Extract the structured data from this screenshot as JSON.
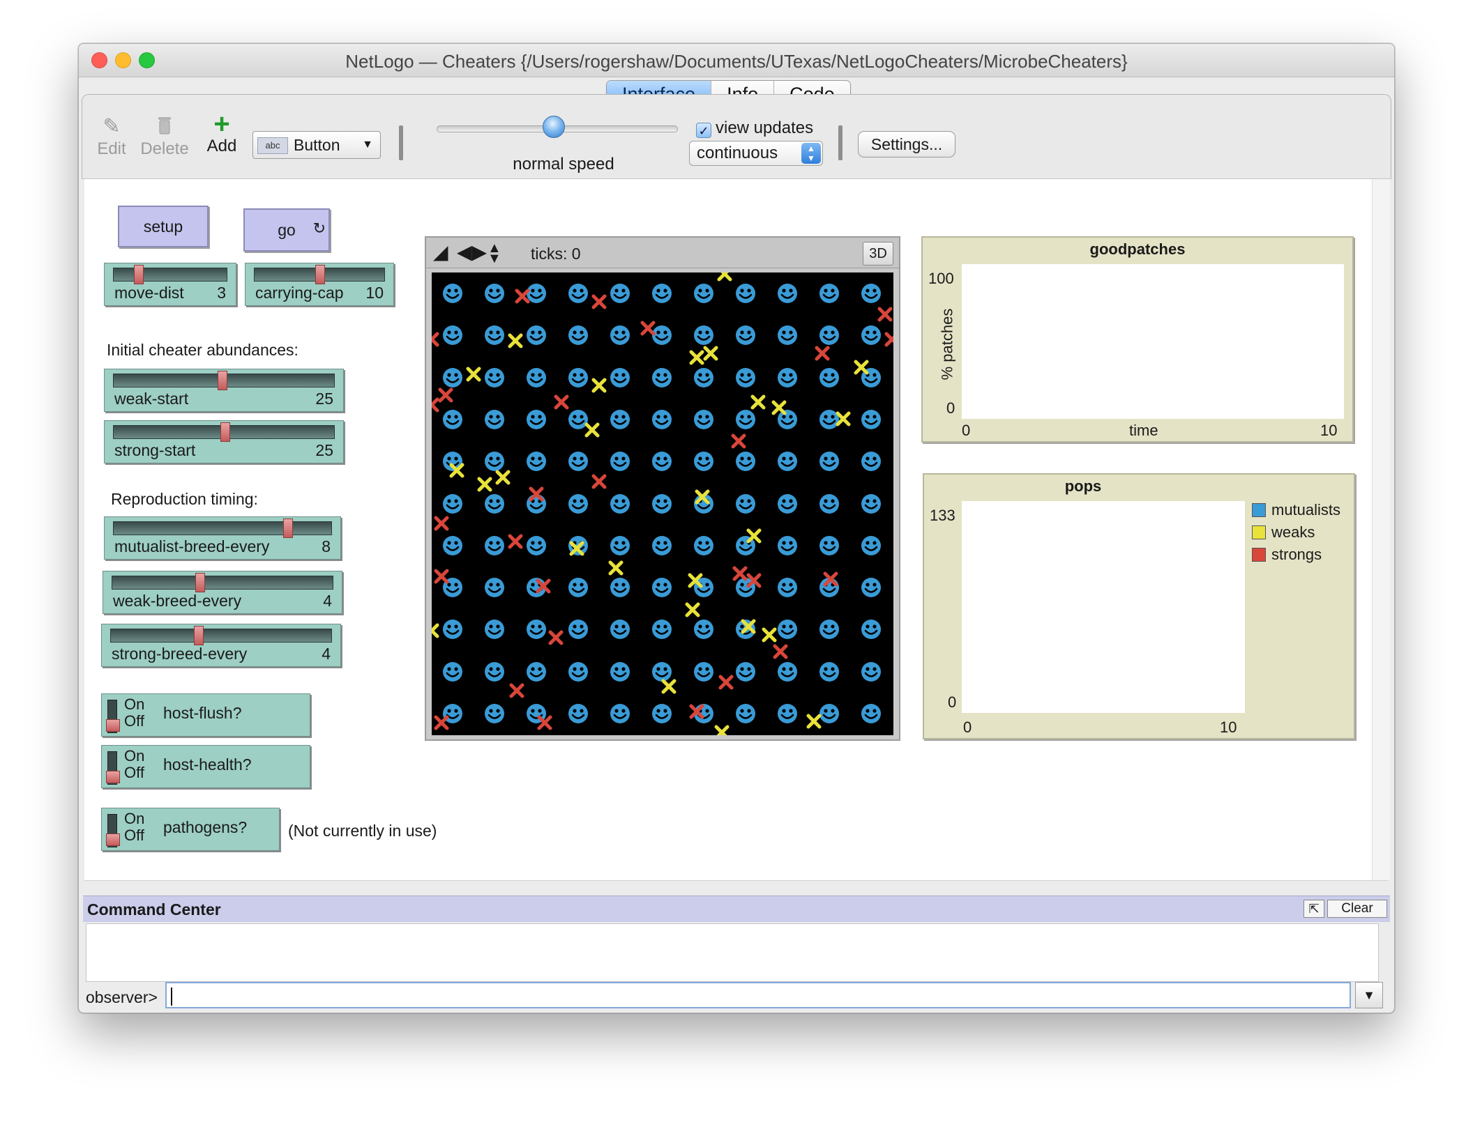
{
  "window": {
    "title": "NetLogo — Cheaters {/Users/rogershaw/Documents/UTexas/NetLogoCheaters/MicrobeCheaters}"
  },
  "tabs": [
    {
      "label": "Interface",
      "active": true
    },
    {
      "label": "Info",
      "active": false
    },
    {
      "label": "Code",
      "active": false
    }
  ],
  "toolbar": {
    "edit_label": "Edit",
    "delete_label": "Delete",
    "add_label": "Add",
    "widget_type": "Button",
    "widget_type_icon_text": "abc",
    "speed_label": "normal speed",
    "speed_fraction": 0.5,
    "view_updates_label": "view updates",
    "view_updates_checked": true,
    "update_mode": "continuous",
    "settings_label": "Settings..."
  },
  "buttons": {
    "setup_label": "setup",
    "go_label": "go"
  },
  "sliders": [
    {
      "name": "move-dist",
      "value": "3",
      "fraction": 0.25
    },
    {
      "name": "carrying-cap",
      "value": "10",
      "fraction": 0.45
    },
    {
      "name": "weak-start",
      "value": "25",
      "fraction": 0.48
    },
    {
      "name": "strong-start",
      "value": "25",
      "fraction": 0.5
    },
    {
      "name": "mutualist-breed-every",
      "value": "8",
      "fraction": 0.82
    },
    {
      "name": "weak-breed-every",
      "value": "4",
      "fraction": 0.38
    },
    {
      "name": "strong-breed-every",
      "value": "4",
      "fraction": 0.38
    }
  ],
  "labels": {
    "initial_cheater": "Initial cheater abundances:",
    "reproduction_timing": "Reproduction timing:",
    "not_in_use": "(Not currently in use)"
  },
  "switches": [
    {
      "name": "host-flush?",
      "on_label": "On",
      "off_label": "Off",
      "state": "off"
    },
    {
      "name": "host-health?",
      "on_label": "On",
      "off_label": "Off",
      "state": "off"
    },
    {
      "name": "pathogens?",
      "on_label": "On",
      "off_label": "Off",
      "state": "off"
    }
  ],
  "view": {
    "ticks_label": "ticks: 0",
    "three_d_label": "3D",
    "colors": {
      "background": "#000000",
      "mutualist": "#3a9bd6",
      "weak": "#e8e23a",
      "strong": "#d9463a"
    }
  },
  "plots": {
    "goodpatches": {
      "title": "goodpatches",
      "ylabel": "% patches",
      "xlabel": "time",
      "y_max": "100",
      "y_min": "0",
      "x_min": "0",
      "x_max": "10"
    },
    "pops": {
      "title": "pops",
      "y_max": "133",
      "y_min": "0",
      "x_min": "0",
      "x_max": "10",
      "legend": [
        {
          "name": "mutualists",
          "color": "#3a9bd6"
        },
        {
          "name": "weaks",
          "color": "#e8e23a"
        },
        {
          "name": "strongs",
          "color": "#d9463a"
        }
      ]
    }
  },
  "command_center": {
    "title": "Command Center",
    "clear_label": "Clear",
    "prompt": "observer>",
    "input_value": ""
  }
}
